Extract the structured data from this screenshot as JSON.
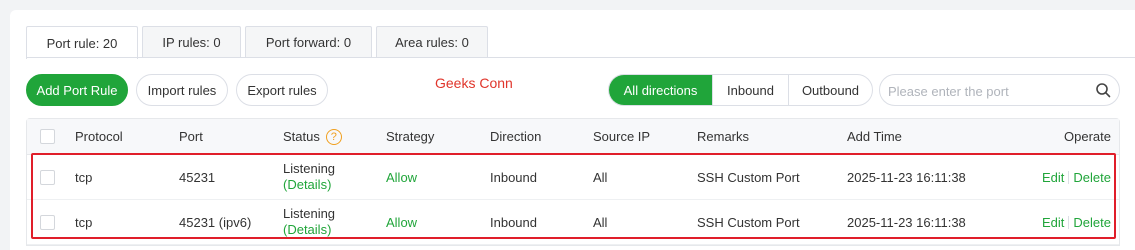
{
  "tabs": [
    {
      "label": "Port rule: 20",
      "active": true
    },
    {
      "label": "IP rules: 0",
      "active": false
    },
    {
      "label": "Port forward: 0",
      "active": false
    },
    {
      "label": "Area rules: 0",
      "active": false
    }
  ],
  "toolbar": {
    "add_label": "Add Port Rule",
    "import_label": "Import rules",
    "export_label": "Export rules",
    "watermark": "Geeks Conn"
  },
  "direction_filter": {
    "options": [
      "All directions",
      "Inbound",
      "Outbound"
    ],
    "selected": "All directions"
  },
  "search": {
    "placeholder": "Please enter the port",
    "value": ""
  },
  "table": {
    "columns": [
      "Protocol",
      "Port",
      "Status",
      "Strategy",
      "Direction",
      "Source IP",
      "Remarks",
      "Add Time",
      "Operate"
    ],
    "rows": [
      {
        "protocol": "tcp",
        "port": "45231",
        "status": "Listening",
        "status_link": "(Details)",
        "strategy": "Allow",
        "direction": "Inbound",
        "source_ip": "All",
        "remarks": "SSH Custom Port",
        "add_time": "2025-11-23 16:11:38",
        "edit": "Edit",
        "delete": "Delete"
      },
      {
        "protocol": "tcp",
        "port": "45231 (ipv6)",
        "status": "Listening",
        "status_link": "(Details)",
        "strategy": "Allow",
        "direction": "Inbound",
        "source_ip": "All",
        "remarks": "SSH Custom Port",
        "add_time": "2025-11-23 16:11:38",
        "edit": "Edit",
        "delete": "Delete"
      }
    ]
  },
  "colors": {
    "accent": "#20a53a",
    "highlight": "#e01e2a",
    "help": "#f0a020"
  },
  "icons": {
    "search": "search-icon",
    "help": "help-icon"
  }
}
